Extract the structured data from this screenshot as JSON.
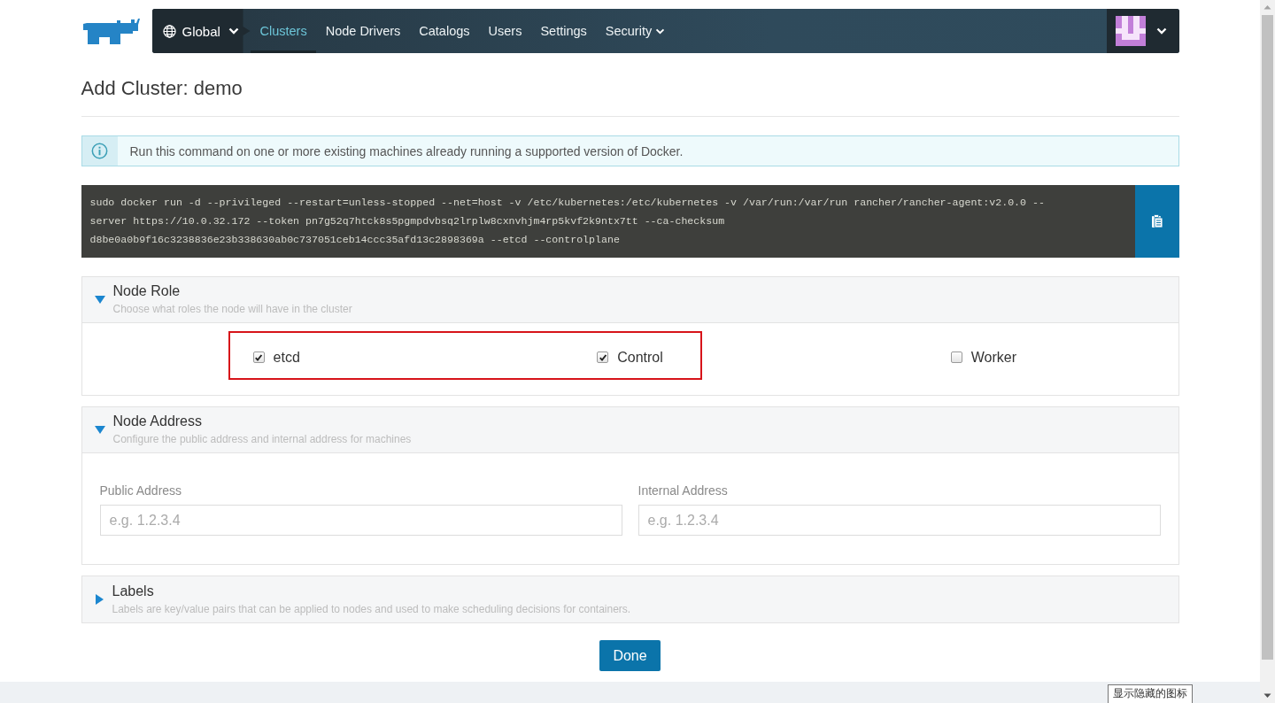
{
  "nav": {
    "scope": {
      "label": "Global"
    },
    "items": [
      {
        "label": "Clusters",
        "selected": true,
        "dropdown": false
      },
      {
        "label": "Node Drivers",
        "selected": false,
        "dropdown": false
      },
      {
        "label": "Catalogs",
        "selected": false,
        "dropdown": false
      },
      {
        "label": "Users",
        "selected": false,
        "dropdown": false
      },
      {
        "label": "Settings",
        "selected": false,
        "dropdown": false
      },
      {
        "label": "Security",
        "selected": false,
        "dropdown": true
      }
    ]
  },
  "page": {
    "title": "Add Cluster: demo"
  },
  "info_banner": {
    "text": "Run this command on one or more existing machines already running a supported version of Docker."
  },
  "command": {
    "text": "sudo docker run -d --privileged --restart=unless-stopped --net=host -v /etc/kubernetes:/etc/kubernetes -v /var/run:/var/run rancher/rancher-agent:v2.0.0 --server https://10.0.32.172 --token pn7g52q7htck8s5pgmpdvbsq2lrplw8cxnvhjm4rp5kvf2k9ntx7tt --ca-checksum d8be0a0b9f16c3238836e23b338630ab0c737051ceb14ccc35afd13c2898369a --etcd --controlplane"
  },
  "sections": [
    {
      "kind": "roles",
      "title": "Node Role",
      "subtitle": "Choose what roles the node will have in the cluster",
      "expanded": true,
      "roles": [
        {
          "label": "etcd",
          "checked": true,
          "highlighted": true
        },
        {
          "label": "Control",
          "checked": true,
          "highlighted": true
        },
        {
          "label": "Worker",
          "checked": false,
          "highlighted": false
        }
      ]
    },
    {
      "kind": "address",
      "title": "Node Address",
      "subtitle": "Configure the public address and internal address for machines",
      "expanded": true,
      "fields": [
        {
          "label": "Public Address",
          "placeholder": "e.g. 1.2.3.4"
        },
        {
          "label": "Internal Address",
          "placeholder": "e.g. 1.2.3.4"
        }
      ]
    },
    {
      "kind": "labels",
      "title": "Labels",
      "subtitle": "Labels are key/value pairs that can be applied to nodes and used to make scheduling decisions for containers.",
      "expanded": false
    }
  ],
  "done_button": {
    "label": "Done"
  },
  "tooltip": {
    "text": "显示隐藏的图标"
  }
}
